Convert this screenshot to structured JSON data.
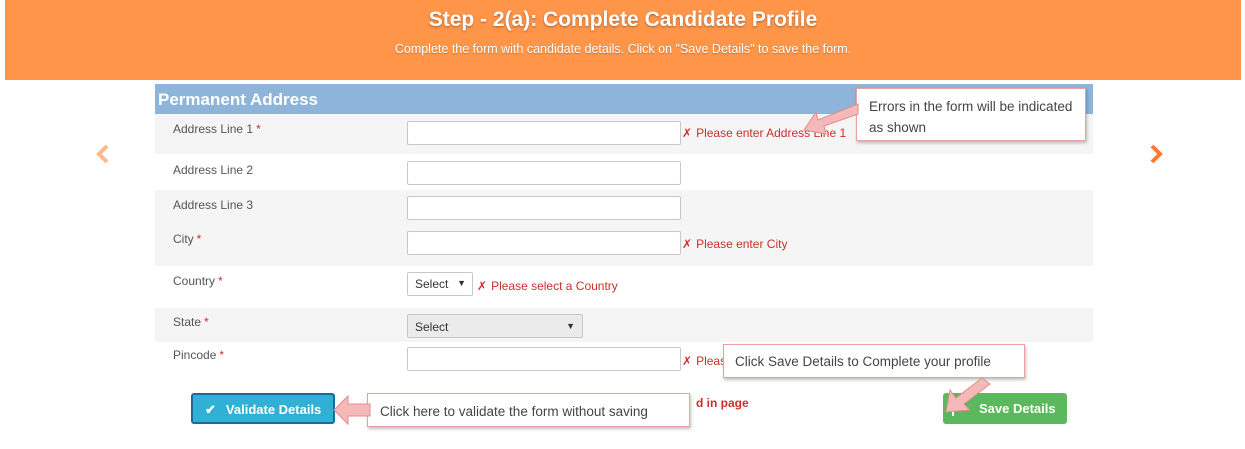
{
  "banner": {
    "title": "Step - 2(a): Complete Candidate Profile",
    "subtitle": "Complete the form with candidate details. Click on \"Save Details\" to save the form."
  },
  "nav": {
    "prev_icon": "chevron-left-icon",
    "next_icon": "chevron-right-icon",
    "color": "#ff7a2e"
  },
  "section": {
    "title": "Permanent Address",
    "header_color": "#8eb4d9"
  },
  "fields": {
    "address1": {
      "label": "Address Line 1",
      "required": "*",
      "value": "",
      "error": "Please enter Address Line 1"
    },
    "address2": {
      "label": "Address Line 2",
      "value": ""
    },
    "address3": {
      "label": "Address Line 3",
      "value": ""
    },
    "city": {
      "label": "City",
      "required": "*",
      "value": "",
      "error": "Please enter City"
    },
    "country": {
      "label": "Country",
      "required": "*",
      "selected": "Select",
      "error": "Please select a Country"
    },
    "state": {
      "label": "State",
      "required": "*",
      "selected": "Select"
    },
    "pincode": {
      "label": "Pincode",
      "required": "*",
      "value": "",
      "error": "Pleas"
    }
  },
  "error_mark": "✗",
  "buttons": {
    "validate": "Validate Details",
    "save": "Save Details"
  },
  "footer_error": "d in page",
  "callouts": {
    "errors": "Errors in the form will be indicated as shown",
    "save": "Click Save Details to Complete your profile",
    "validate": "Click here to validate the form without saving"
  },
  "colors": {
    "banner": "#ff9549",
    "error": "#c9302c",
    "validate": "#31b0d5",
    "save": "#5cb85c"
  }
}
